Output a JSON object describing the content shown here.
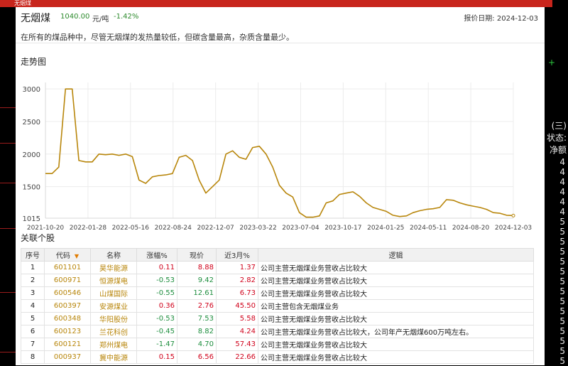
{
  "window": {
    "title": "无烟煤"
  },
  "header": {
    "name": "无烟煤",
    "price": "1040.00",
    "unit": "元/吨",
    "change": "-1.42%",
    "date_label": "报价日期:",
    "date": "2024-12-03"
  },
  "description": "在所有的煤品种中，尽管无烟煤的发热量较低，但碳含量最高，杂质含量最少。",
  "trend_title": "走势图",
  "chart_data": {
    "type": "line",
    "title": "",
    "xlabel": "",
    "ylabel": "",
    "x_ticks": [
      "2021-10-20",
      "2022-01-28",
      "2022-05-16",
      "2022-08-24",
      "2022-12-07",
      "2023-03-22",
      "2023-07-04",
      "2023-10-17",
      "2024-01-25",
      "2024-05-11",
      "2024-08-20",
      "2024-12-03"
    ],
    "y_ticks": [
      1015,
      1500,
      2000,
      2500,
      3000
    ],
    "ylim": [
      1015,
      3100
    ],
    "grid": true,
    "color": "#b8860b",
    "series": [
      {
        "values": [
          [
            0,
            1700
          ],
          [
            1,
            1700
          ],
          [
            2,
            1800
          ],
          [
            3,
            3000
          ],
          [
            4,
            3000
          ],
          [
            5,
            1900
          ],
          [
            6,
            1880
          ],
          [
            7,
            1880
          ],
          [
            8,
            2000
          ],
          [
            9,
            1990
          ],
          [
            10,
            2000
          ],
          [
            11,
            1980
          ],
          [
            12,
            2000
          ],
          [
            13,
            1960
          ],
          [
            14,
            1600
          ],
          [
            15,
            1550
          ],
          [
            16,
            1650
          ],
          [
            17,
            1670
          ],
          [
            18,
            1680
          ],
          [
            19,
            1700
          ],
          [
            20,
            1950
          ],
          [
            21,
            1980
          ],
          [
            22,
            1900
          ],
          [
            23,
            1600
          ],
          [
            24,
            1400
          ],
          [
            25,
            1500
          ],
          [
            26,
            1600
          ],
          [
            27,
            2000
          ],
          [
            28,
            2050
          ],
          [
            29,
            1950
          ],
          [
            30,
            1920
          ],
          [
            31,
            2100
          ],
          [
            32,
            2120
          ],
          [
            33,
            2000
          ],
          [
            34,
            1800
          ],
          [
            35,
            1520
          ],
          [
            36,
            1400
          ],
          [
            37,
            1340
          ],
          [
            38,
            1100
          ],
          [
            39,
            1030
          ],
          [
            40,
            1030
          ],
          [
            41,
            1050
          ],
          [
            42,
            1250
          ],
          [
            43,
            1280
          ],
          [
            44,
            1380
          ],
          [
            45,
            1400
          ],
          [
            46,
            1420
          ],
          [
            47,
            1350
          ],
          [
            48,
            1250
          ],
          [
            49,
            1180
          ],
          [
            50,
            1150
          ],
          [
            51,
            1120
          ],
          [
            52,
            1060
          ],
          [
            53,
            1040
          ],
          [
            54,
            1050
          ],
          [
            55,
            1100
          ],
          [
            56,
            1130
          ],
          [
            57,
            1150
          ],
          [
            58,
            1160
          ],
          [
            59,
            1180
          ],
          [
            60,
            1300
          ],
          [
            61,
            1290
          ],
          [
            62,
            1250
          ],
          [
            63,
            1220
          ],
          [
            64,
            1200
          ],
          [
            65,
            1180
          ],
          [
            66,
            1150
          ],
          [
            67,
            1100
          ],
          [
            68,
            1090
          ],
          [
            69,
            1060
          ],
          [
            70,
            1055
          ]
        ]
      }
    ]
  },
  "related_title": "关联个股",
  "table": {
    "columns": [
      "序号",
      "代码",
      "名称",
      "涨幅%",
      "现价",
      "近3月%",
      "逻辑"
    ],
    "rows": [
      {
        "no": "1",
        "code": "601101",
        "name": "昊华能源",
        "chg": "0.11",
        "price": "8.88",
        "m3": "1.37",
        "logic": "公司主营无烟煤业务营收占比较大",
        "dir": "up"
      },
      {
        "no": "2",
        "code": "600971",
        "name": "恒源煤电",
        "chg": "-0.53",
        "price": "9.42",
        "m3": "2.82",
        "logic": "公司主营无烟煤业务营收占比较大",
        "dir": "dn"
      },
      {
        "no": "3",
        "code": "600546",
        "name": "山煤国际",
        "chg": "-0.55",
        "price": "12.61",
        "m3": "6.73",
        "logic": "公司主营无烟煤业务营收占比较大",
        "dir": "dn"
      },
      {
        "no": "4",
        "code": "600397",
        "name": "安源煤业",
        "chg": "0.36",
        "price": "2.76",
        "m3": "45.50",
        "logic": "公司主营包含无烟煤业务",
        "dir": "up"
      },
      {
        "no": "5",
        "code": "600348",
        "name": "华阳股份",
        "chg": "-0.53",
        "price": "7.53",
        "m3": "5.58",
        "logic": "公司主营无烟煤业务营收占比较大",
        "dir": "dn"
      },
      {
        "no": "6",
        "code": "600123",
        "name": "兰花科创",
        "chg": "-0.45",
        "price": "8.82",
        "m3": "4.24",
        "logic": "公司主营无烟煤业务营收占比较大，公司年产无烟煤600万吨左右。",
        "dir": "dn"
      },
      {
        "no": "7",
        "code": "600121",
        "name": "郑州煤电",
        "chg": "-1.47",
        "price": "4.70",
        "m3": "57.43",
        "logic": "公司主营无烟煤业务营收占比较大",
        "dir": "dn"
      },
      {
        "no": "8",
        "code": "000937",
        "name": "冀中能源",
        "chg": "0.15",
        "price": "6.56",
        "m3": "22.66",
        "logic": "公司主营无烟煤业务营收占比较大",
        "dir": "up"
      }
    ]
  },
  "background": {
    "right_labels": [
      "(三)",
      "状态:",
      "净额"
    ],
    "right_numbers": [
      "4",
      "4",
      "4",
      "4",
      "4",
      "4",
      "5",
      "5",
      "5",
      "5",
      "5",
      "5",
      "5",
      "5",
      "5",
      "5",
      "5",
      "5",
      "5",
      "5",
      "5"
    ]
  }
}
